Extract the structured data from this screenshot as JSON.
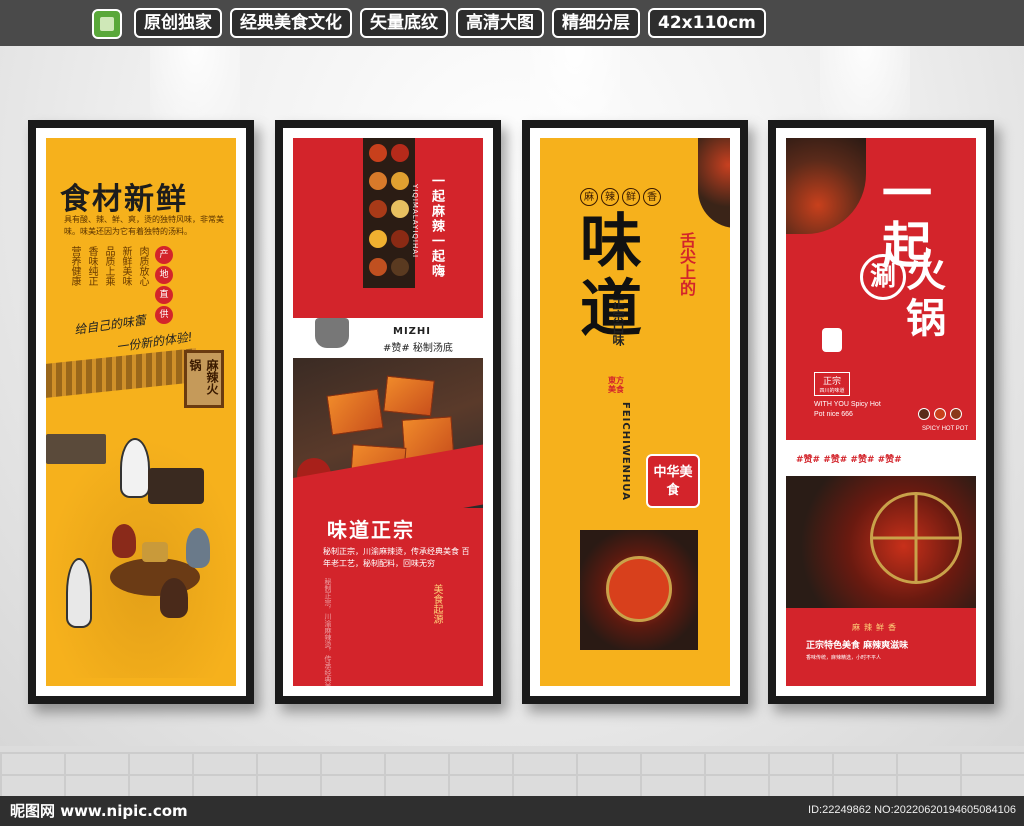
{
  "topbar": {
    "tags": [
      "原创独家",
      "经典美食文化",
      "矢量底纹",
      "高清大图",
      "精细分层",
      "42x110cm"
    ]
  },
  "poster1": {
    "title": "食材新鲜",
    "desc": "具有酸、辣、鲜、爽，烫的独特风味，非常美味。味美还因为它有着独特的汤料。",
    "columns": [
      "营养健康",
      "香味纯正",
      "品质上乘",
      "新鲜美味",
      "肉质放心"
    ],
    "seals": [
      "产",
      "地",
      "直",
      "供"
    ],
    "slogan1": "给自己的味蕾",
    "slogan2": "一份新的体验!",
    "sign": "麻辣火锅"
  },
  "poster2": {
    "vtitle": "一起麻辣一起嗨",
    "vsub": "YIQIMALAYIQIHAI",
    "mizhi": "MIZHI",
    "mizhi2": "#赞# 秘制汤底",
    "heading": "味道正宗",
    "desc": "秘制正宗，川渝麻辣烫，传承经典美食 百年老工艺，秘制配料，回味无穷",
    "side": "美食起源"
  },
  "poster3": {
    "pills": [
      "麻",
      "辣",
      "鲜",
      "香"
    ],
    "big": "味道",
    "red": "舌尖上的",
    "zz": "正宗口味",
    "dongfang": "東方美食",
    "pinyin": "FEICHIWENHUA",
    "zhonghua": "中华美食"
  },
  "poster4": {
    "big1": "一起",
    "circle": "涮",
    "big2": "火锅",
    "stamp": "正宗",
    "stamp_sub": "四川的味道",
    "en": "WITH YOU Spicy Hot Pot nice 666",
    "en2": "SPICY HOT POT",
    "likes": "#赞#  #赞#  #赞#  #赞#",
    "tags": "麻辣鲜香",
    "slogan": "正宗特色美食 麻辣爽滋味",
    "tiny": "香味传统，麻辣精选，小时不平人"
  },
  "footer": {
    "left": "昵图网 www.nipic.com",
    "right": "ID:22249862 NO:20220620194605084106"
  },
  "colors": {
    "poster_red": "#d3242b",
    "poster_yellow": "#f6b11c",
    "frame": "#1a1a1a",
    "topbar": "#4a4a4a"
  }
}
